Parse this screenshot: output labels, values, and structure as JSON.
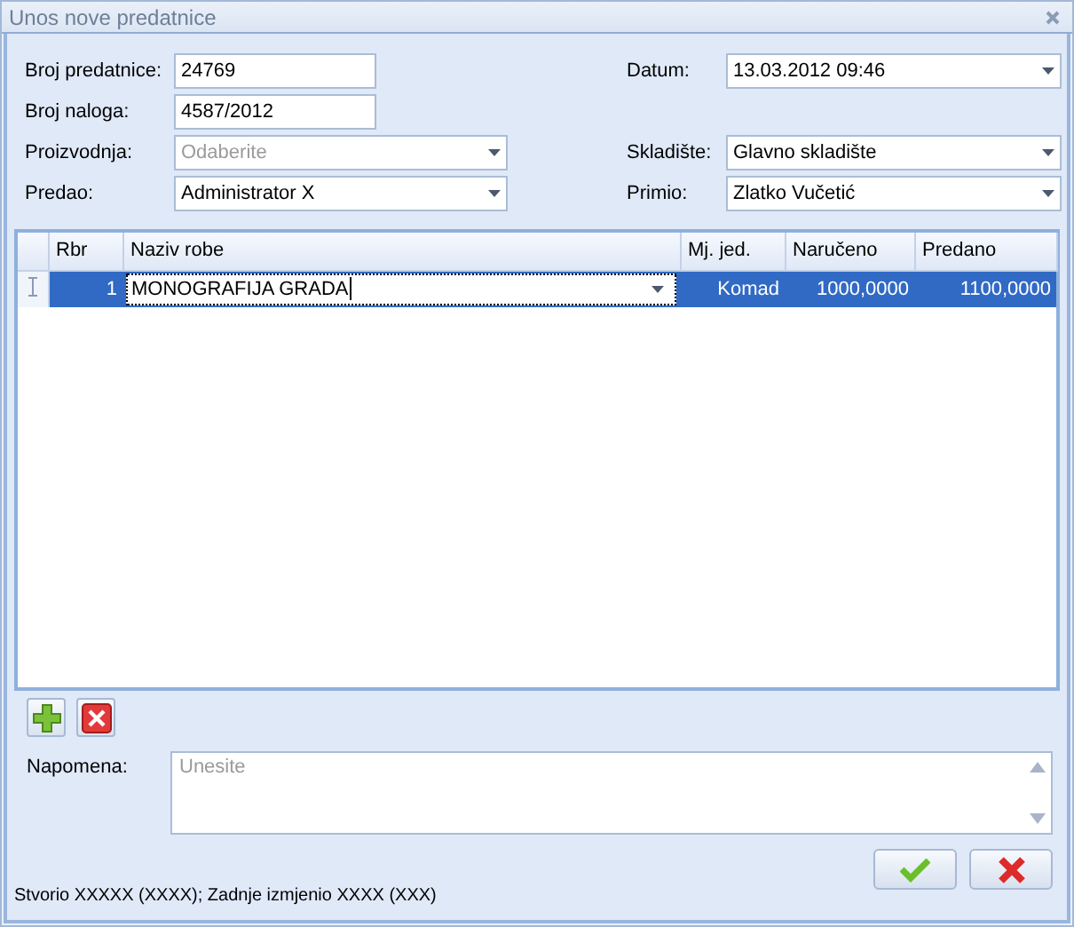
{
  "window": {
    "title": "Unos nove predatnice"
  },
  "form_rows": [
    {
      "left": {
        "kind": "text",
        "label": "Broj predatnice:",
        "value": "24769"
      },
      "right": {
        "kind": "dropdown",
        "label": "Datum:",
        "value": "13.03.2012 09:46"
      }
    },
    {
      "left": {
        "kind": "text",
        "label": "Broj naloga:",
        "value": "4587/2012"
      }
    },
    {
      "left": {
        "kind": "dropdown",
        "label": "Proizvodnja:",
        "placeholder": "Odaberite"
      },
      "right": {
        "kind": "dropdown",
        "label": "Skladište:",
        "value": "Glavno skladište"
      }
    },
    {
      "left": {
        "kind": "dropdown",
        "label": "Predao:",
        "value": "Administrator X"
      },
      "right": {
        "kind": "dropdown",
        "label": "Primio:",
        "value": "Zlatko Vučetić"
      }
    }
  ],
  "table": {
    "columns": [
      "Rbr",
      "Naziv robe",
      "Mj. jed.",
      "Naručeno",
      "Predano"
    ],
    "rows": [
      {
        "selected": true,
        "cells": [
          {
            "text": "1",
            "editing": false
          },
          {
            "text": "MONOGRAFIJA GRADA",
            "editing": true
          },
          {
            "text": "Komad",
            "editing": false
          },
          {
            "text": "1000,0000",
            "editing": false
          },
          {
            "text": "1100,0000",
            "editing": false
          }
        ]
      }
    ]
  },
  "toolbar": [
    {
      "kind": "add"
    },
    {
      "kind": "delete"
    }
  ],
  "note": {
    "label": "Napomena:",
    "placeholder": "Unesite"
  },
  "actions": [
    {
      "kind": "ok"
    },
    {
      "kind": "cancel"
    }
  ],
  "status_bar": "Stvorio XXXXX (XXXX); Zadnje izmjenio XXXX (XXX)"
}
